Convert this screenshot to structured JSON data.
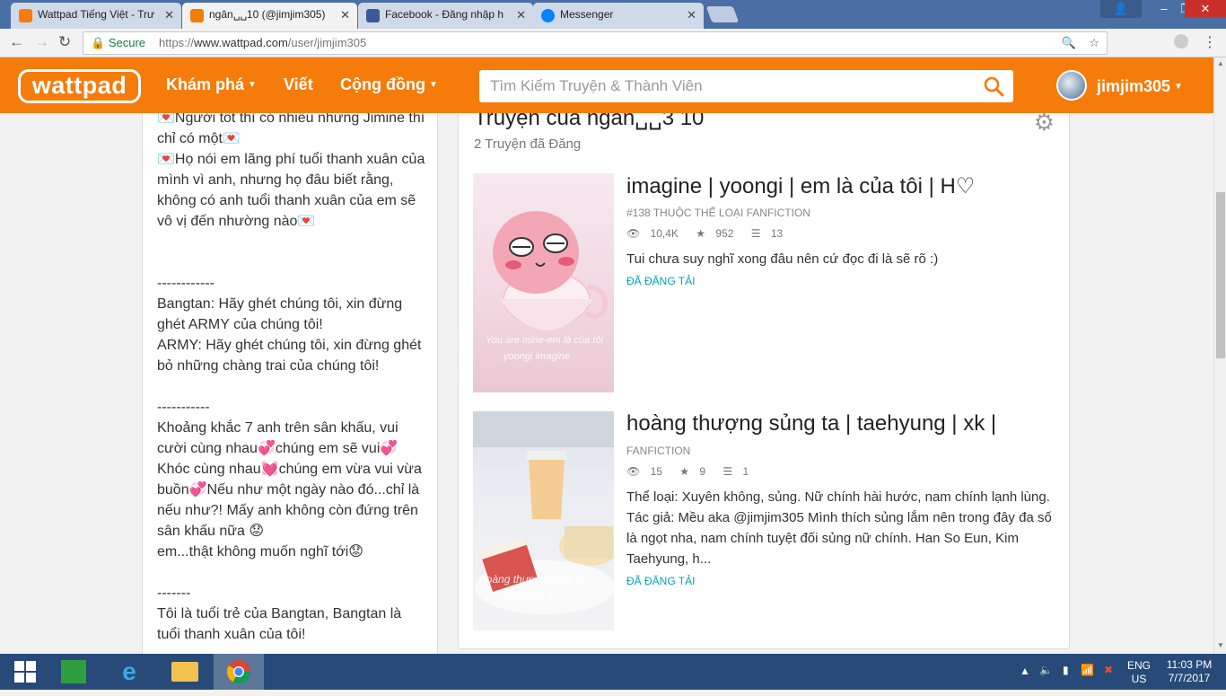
{
  "browser": {
    "tabs": [
      {
        "title": "Wattpad Tiếng Việt - Trư",
        "favicon_color": "#f57c0a"
      },
      {
        "title": "ngân␣␣10 (@jimjim305)",
        "favicon_color": "#f57c0a"
      },
      {
        "title": "Facebook - Đăng nhập h",
        "favicon_color": "#3b5998"
      },
      {
        "title": "Messenger",
        "favicon_color": "#0084ff"
      }
    ],
    "close_glyph": "✕",
    "secure_label": "Secure",
    "url_scheme": "https://",
    "url_host": "www.wattpad.com",
    "url_path": "/user/jimjim305"
  },
  "header": {
    "logo": "wattpad",
    "nav": {
      "explore": "Khám phá",
      "write": "Viết",
      "community": "Cộng đồng"
    },
    "search_placeholder": "Tìm Kiếm Truyện & Thành Viên",
    "username": "jimjim305",
    "brand_color": "#f57c0a"
  },
  "bio": {
    "lines": [
      "💌Người tốt thì có nhiều nhưng Jimine thì chỉ có một💌",
      "💌Họ nói em lãng phí tuổi thanh xuân của mình vì anh, nhưng họ đâu biết rằng, không có anh tuổi thanh xuân của em sẽ vô vị đến nhường nào💌",
      "",
      "------------",
      "Bangtan: Hãy ghét chúng tôi, xin đừng ghét ARMY của chúng tôi!",
      "ARMY: Hãy ghét chúng tôi, xin đừng ghét bỏ những chàng trai của chúng tôi!",
      "",
      "-----------",
      "Khoảng khắc 7 anh trên sân khấu, vui cười cùng nhau💞chúng em sẽ vui💞",
      "Khóc cùng nhau💓chúng em vừa vui vừa buồn💞Nếu như một ngày nào đó...chỉ là nếu như?! Mấy anh không còn đứng trên sân khấu nữa 😟",
      "em...thật không muốn nghĩ tới😟",
      "",
      "-------",
      "Tôi là tuổi trẻ của Bangtan, Bangtan là tuổi thanh xuân của tôi!"
    ]
  },
  "stories": {
    "title": "Truyện của ngân␣␣3 10",
    "count_label": "2 Truyện đã Đăng",
    "items": [
      {
        "title": "imagine | yoongi | em là của tôi | H♡",
        "meta": "#138 THUỘC THỂ LOẠI FANFICTION",
        "reads": "10,4K",
        "votes": "952",
        "parts": "13",
        "description": "Tui chưa suy nghĩ xong đâu nên cứ đọc đi là sẽ rõ :)",
        "status": "ĐÃ ĐĂNG TẢI",
        "cover_caption_1": "You are mine-em là của tôi",
        "cover_caption_2": "yoongi imagine"
      },
      {
        "title": "hoàng thượng sủng ta | taehyung | xk |",
        "meta": "FANFICTION",
        "reads": "15",
        "votes": "9",
        "parts": "1",
        "description": "Thể loại: Xuyên không, sủng. Nữ chính hài hước, nam chính lạnh lùng. Tác giả: Mều aka @jimjim305 Mình thích sủng lắm nên trong đây đa số là ngọt nha, nam chính tuyệt đối sủng nữ chính. Han So Eun, Kim Taehyung, h...",
        "status": "ĐÃ ĐĂNG TẢI",
        "cover_caption_1": "hoàng thượng sủng ta",
        "cover_caption_2": "taehyung ff"
      }
    ]
  },
  "taskbar": {
    "lang_1": "ENG",
    "lang_2": "US",
    "time": "11:03 PM",
    "date": "7/7/2017"
  }
}
